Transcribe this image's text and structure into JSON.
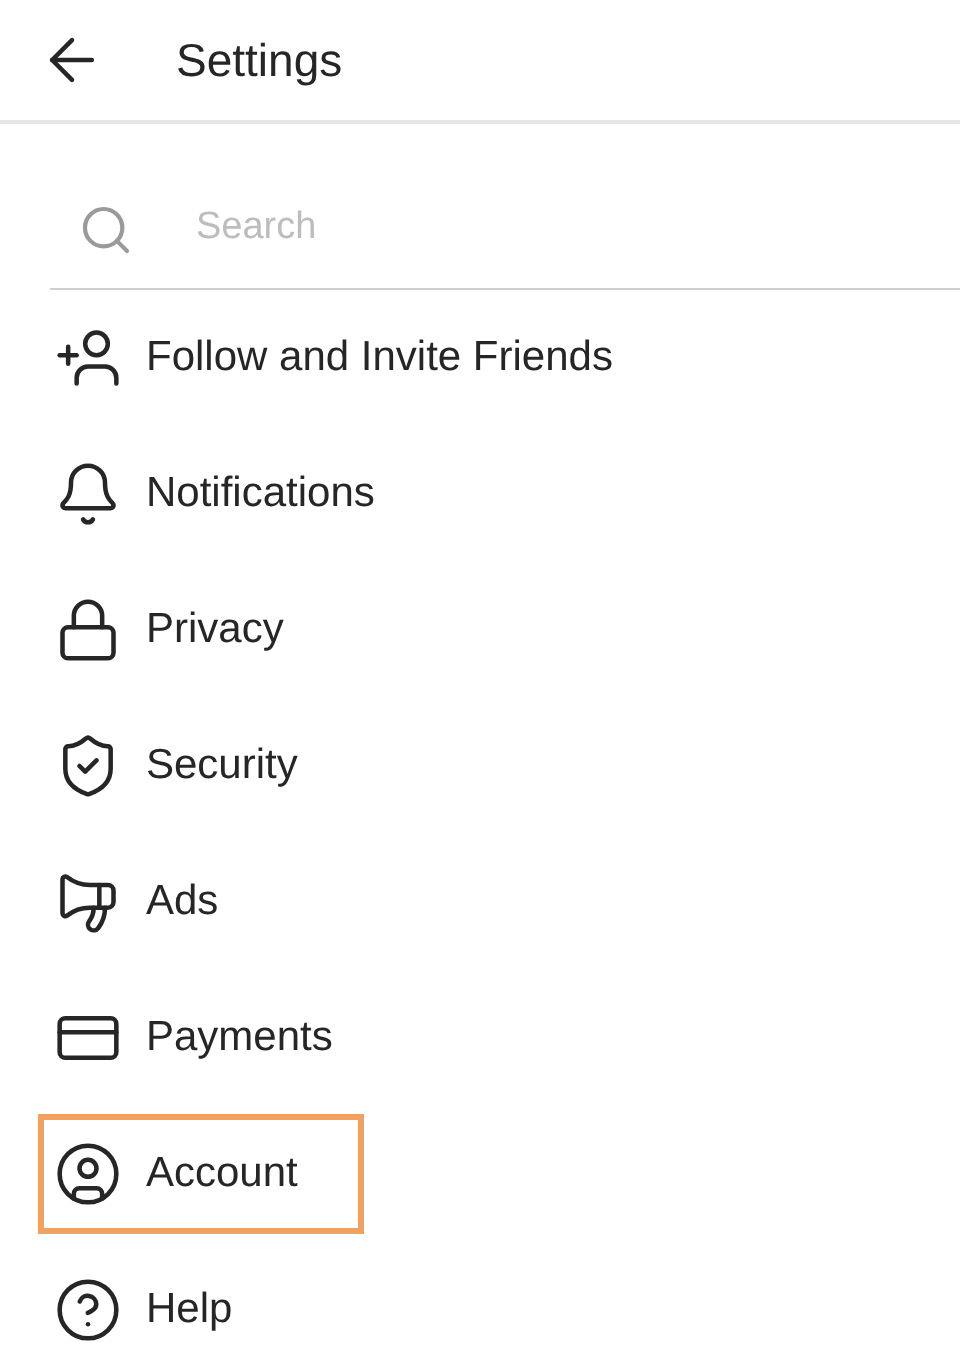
{
  "header": {
    "title": "Settings"
  },
  "search": {
    "placeholder": "Search"
  },
  "items": [
    {
      "label": "Follow and Invite Friends",
      "highlighted": false
    },
    {
      "label": "Notifications",
      "highlighted": false
    },
    {
      "label": "Privacy",
      "highlighted": false
    },
    {
      "label": "Security",
      "highlighted": false
    },
    {
      "label": "Ads",
      "highlighted": false
    },
    {
      "label": "Payments",
      "highlighted": false
    },
    {
      "label": "Account",
      "highlighted": true
    },
    {
      "label": "Help",
      "highlighted": false
    }
  ]
}
